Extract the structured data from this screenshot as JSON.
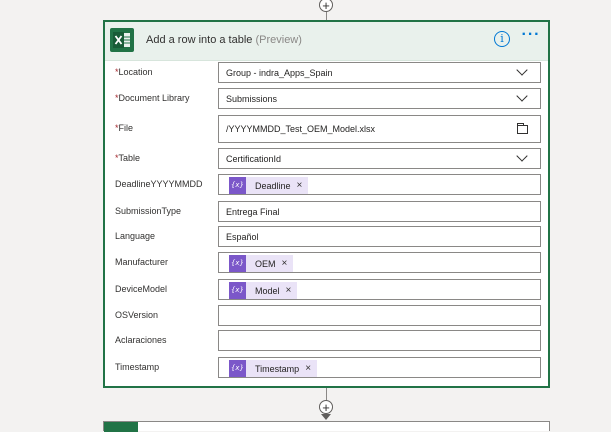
{
  "action": {
    "title": "Add a row into a table",
    "preview_tag": "(Preview)",
    "info_glyph": "i",
    "more_glyph": "···"
  },
  "fields": [
    {
      "label": "Location",
      "required": true,
      "value": "Group - indra_Apps_Spain",
      "kind": "dropdown"
    },
    {
      "label": "Document Library",
      "required": true,
      "value": "Submissions",
      "kind": "dropdown"
    },
    {
      "label": "File",
      "required": true,
      "value": "/YYYYMMDD_Test_OEM_Model.xlsx",
      "kind": "file"
    },
    {
      "label": "Table",
      "required": true,
      "value": "CertificationId",
      "kind": "dropdown"
    },
    {
      "label": "DeadlineYYYYMMDD",
      "required": false,
      "token": "Deadline",
      "kind": "token"
    },
    {
      "label": "SubmissionType",
      "required": false,
      "value": "Entrega Final",
      "kind": "text"
    },
    {
      "label": "Language",
      "required": false,
      "value": "Español",
      "kind": "text"
    },
    {
      "label": "Manufacturer",
      "required": false,
      "token": "OEM",
      "kind": "token"
    },
    {
      "label": "DeviceModel",
      "required": false,
      "token": "Model",
      "kind": "token"
    },
    {
      "label": "OSVersion",
      "required": false,
      "value": "",
      "kind": "text"
    },
    {
      "label": "Aclaraciones",
      "required": false,
      "value": "",
      "kind": "text"
    },
    {
      "label": "Timestamp",
      "required": false,
      "token": "Timestamp",
      "kind": "token"
    }
  ],
  "glyphs": {
    "required_mark": "*",
    "token_expression": "{x}",
    "token_remove": "×",
    "add_step": "+"
  },
  "icons": {
    "app": "excel-icon",
    "file_picker": "folder-icon",
    "dropdown": "chevron-down-icon",
    "token": "expression-icon"
  },
  "colors": {
    "excel_green": "#217346",
    "header_bg": "#e9f1ec",
    "token_bg": "#eae3f7",
    "token_icon": "#7b57c9",
    "link_blue": "#0078d4",
    "required_red": "#a4262c"
  }
}
